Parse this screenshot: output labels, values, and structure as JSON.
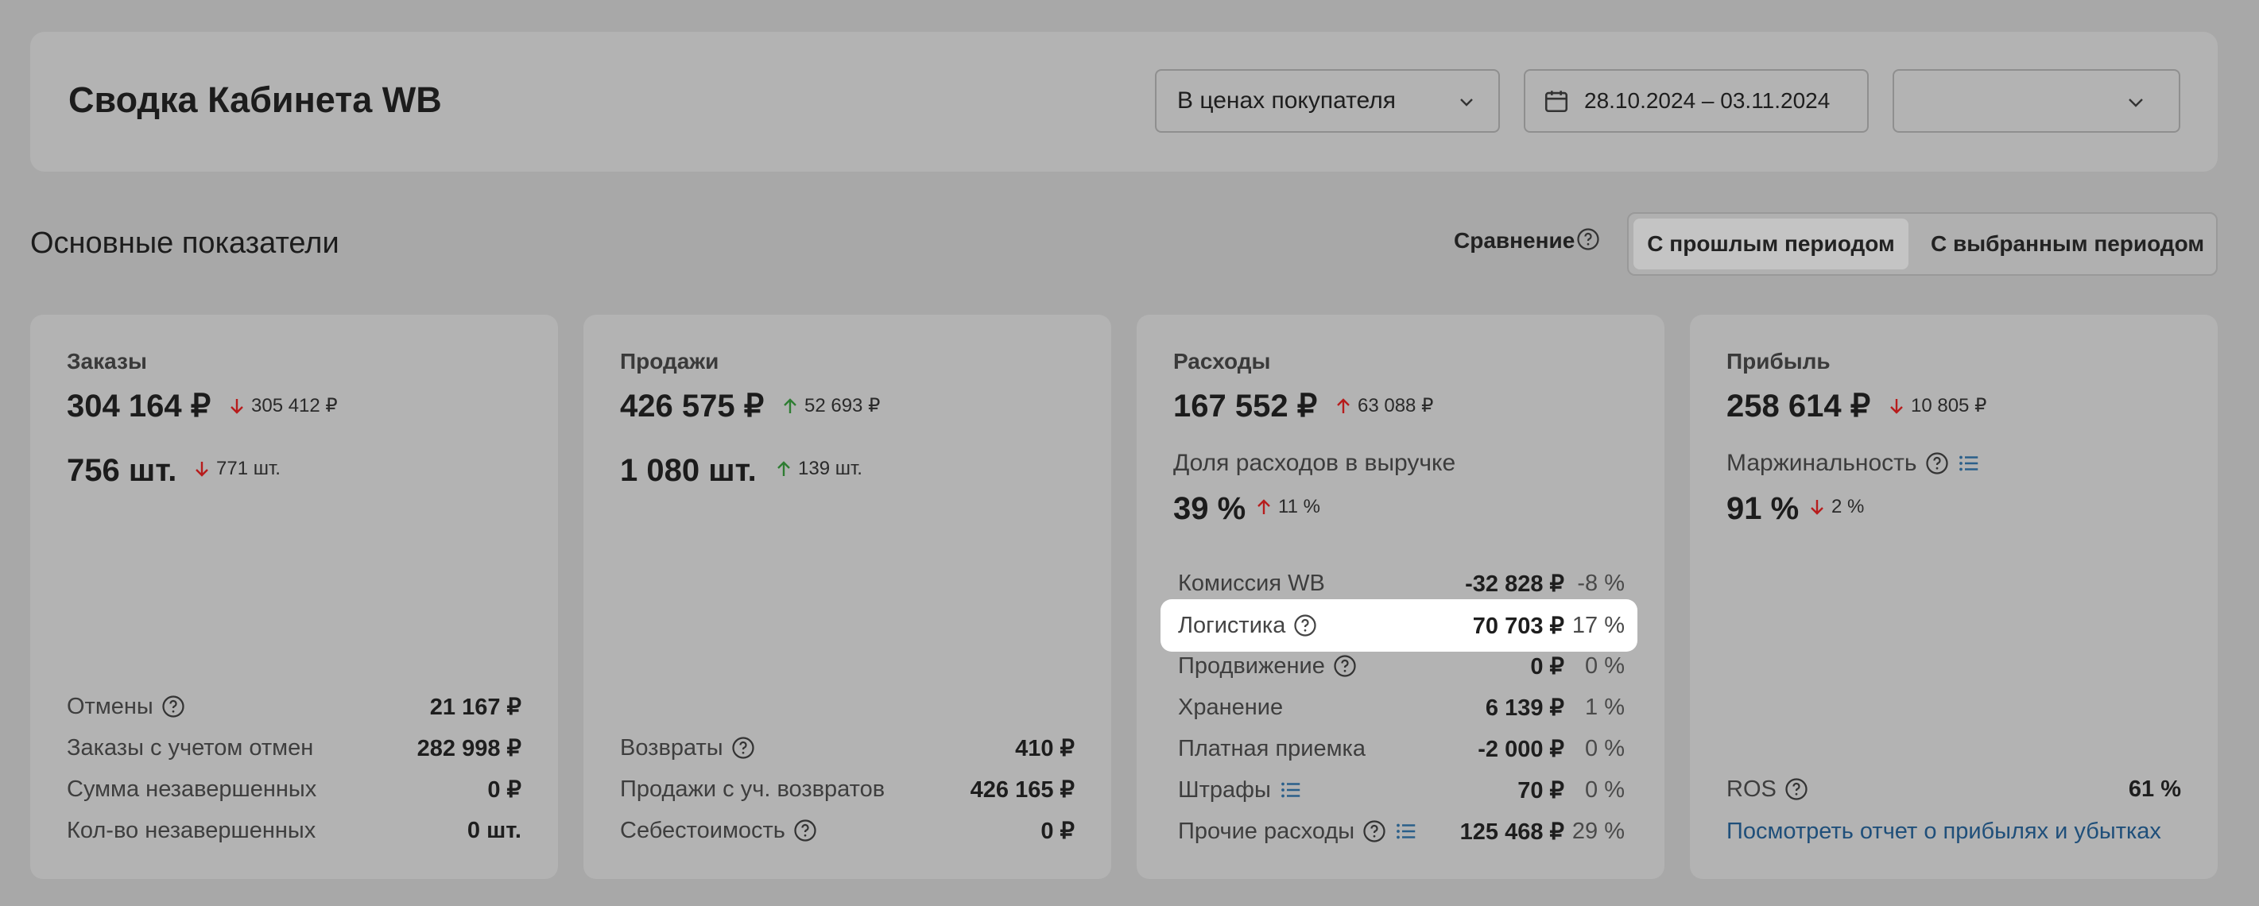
{
  "header": {
    "title": "Сводка Кабинета WB",
    "price_mode": "В ценах покупателя",
    "date_range": "28.10.2024 – 03.11.2024",
    "third_select": ""
  },
  "section": {
    "title": "Основные показатели",
    "compare_label": "Сравнение",
    "compare_options": [
      "С прошлым периодом",
      "С выбранным периодом"
    ],
    "compare_selected": "С прошлым периодом"
  },
  "colors": {
    "up": "#2e7d32",
    "down": "#b71c1c",
    "link": "#1f4f7a",
    "highlight": "#ffffff"
  },
  "cards": {
    "orders": {
      "title": "Заказы",
      "amount": "304 164 ₽",
      "amount_delta": "305 412 ₽",
      "amount_delta_dir": "down",
      "count": "756 шт.",
      "count_delta": "771 шт.",
      "count_delta_dir": "down",
      "rows": [
        {
          "label": "Отмены",
          "value": "21 167 ₽",
          "help": true
        },
        {
          "label": "Заказы с учетом отмен",
          "value": "282 998 ₽"
        },
        {
          "label": "Сумма незавершенных",
          "value": "0 ₽"
        },
        {
          "label": "Кол-во незавершенных",
          "value": "0 шт."
        }
      ]
    },
    "sales": {
      "title": "Продажи",
      "amount": "426 575 ₽",
      "amount_delta": "52 693 ₽",
      "amount_delta_dir": "up",
      "count": "1 080 шт.",
      "count_delta": "139 шт.",
      "count_delta_dir": "up",
      "rows": [
        {
          "label": "Возвраты",
          "value": "410 ₽",
          "help": true
        },
        {
          "label": "Продажи с уч. возвратов",
          "value": "426 165 ₽"
        },
        {
          "label": "Себестоимость",
          "value": "0 ₽",
          "help": true
        }
      ]
    },
    "costs": {
      "title": "Расходы",
      "amount": "167 552 ₽",
      "amount_delta": "63 088 ₽",
      "amount_delta_dir": "up",
      "share_label": "Доля расходов в выручке",
      "share": "39 %",
      "share_delta": "11 %",
      "share_delta_dir": "up",
      "rows": [
        {
          "label": "Комиссия WB",
          "value": "-32 828 ₽",
          "pct": "-8 %"
        },
        {
          "label": "Логистика",
          "value": "70 703 ₽",
          "pct": "17 %",
          "help": true,
          "highlighted": true
        },
        {
          "label": "Продвижение",
          "value": "0 ₽",
          "pct": "0 %",
          "help": true
        },
        {
          "label": "Хранение",
          "value": "6 139 ₽",
          "pct": "1 %"
        },
        {
          "label": "Платная приемка",
          "value": "-2 000 ₽",
          "pct": "0 %"
        },
        {
          "label": "Штрафы",
          "value": "70 ₽",
          "pct": "0 %",
          "list": true
        },
        {
          "label": "Прочие расходы",
          "value": "125 468 ₽",
          "pct": "29 %",
          "help": true,
          "list": true
        }
      ]
    },
    "profit": {
      "title": "Прибыль",
      "amount": "258 614 ₽",
      "amount_delta": "10 805 ₽",
      "amount_delta_dir": "down",
      "margin_label": "Маржинальность",
      "margin": "91 %",
      "margin_delta": "2 %",
      "margin_delta_dir": "down",
      "ros_label": "ROS",
      "ros_value": "61 %",
      "report_link": "Посмотреть отчет о прибылях и убытках"
    }
  }
}
